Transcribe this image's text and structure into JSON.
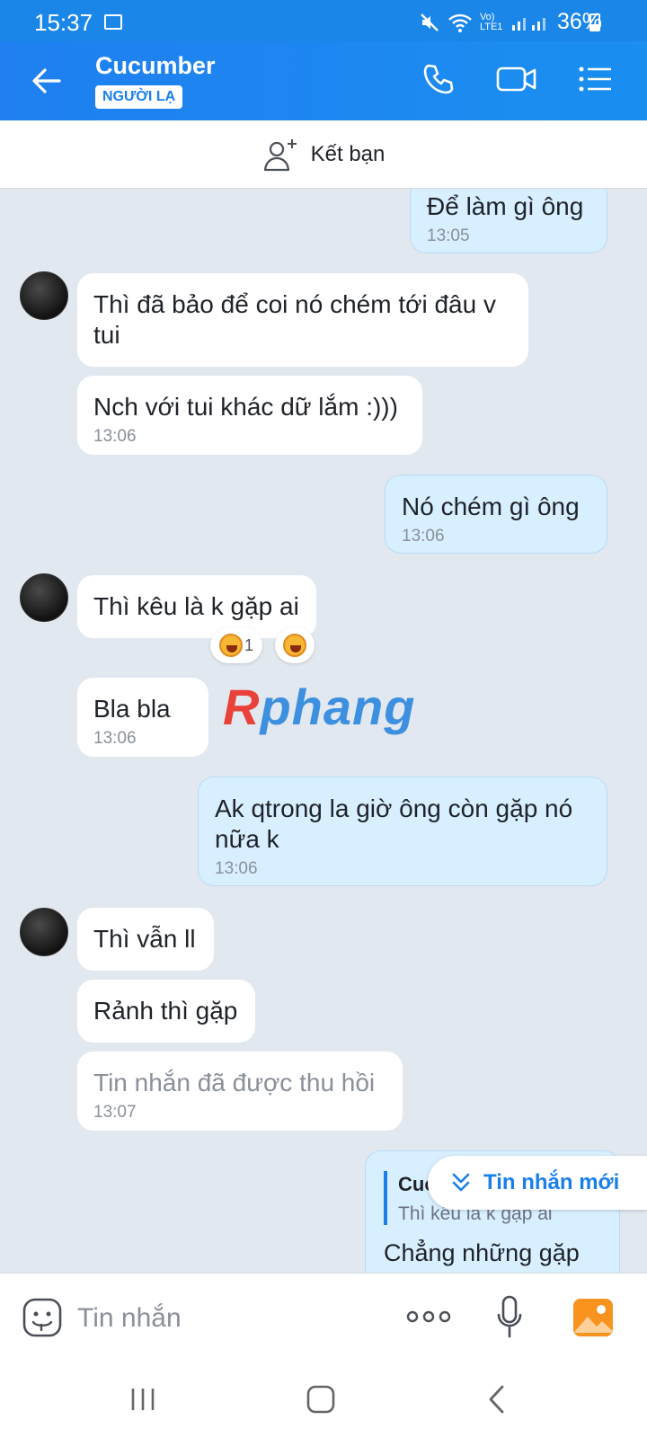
{
  "status": {
    "time": "15:37",
    "network": "Vo) LTE1",
    "battery": "36%"
  },
  "header": {
    "name": "Cucumber",
    "badge": "NGƯỜI LẠ"
  },
  "add_friend": {
    "label": "Kết bạn"
  },
  "messages": [
    {
      "text": "Để làm gì ông",
      "time": "13:05"
    },
    {
      "text": "Thì đã bảo để coi nó chém tới đâu v tui"
    },
    {
      "text": "Nch với tui khác dữ lắm :)))",
      "time": "13:06"
    },
    {
      "text": "Nó chém gì ông",
      "time": "13:06"
    },
    {
      "text": "Thì kêu là k gặp ai"
    },
    {
      "text": "Bla bla",
      "time": "13:06"
    },
    {
      "text": "Ak qtrong la giờ ông còn gặp nó nữa k",
      "time": "13:06"
    },
    {
      "text": "Thì vẫn ll"
    },
    {
      "text": "Rảnh thì gặp"
    },
    {
      "text": "Tin nhắn đã được thu hồi",
      "time": "13:07"
    }
  ],
  "reaction": {
    "count": "1"
  },
  "watermark": {
    "first": "R",
    "rest": "phang"
  },
  "reply": {
    "name": "Cucumber",
    "quote": "Thì kêu là k gặp ai",
    "text": "Chẳng những gặp"
  },
  "new_message": {
    "label": "Tin nhắn mới"
  },
  "composer": {
    "placeholder": "Tin nhắn"
  },
  "colors": {
    "accent": "#1a7fe8",
    "out_bubble": "#d8efff"
  }
}
